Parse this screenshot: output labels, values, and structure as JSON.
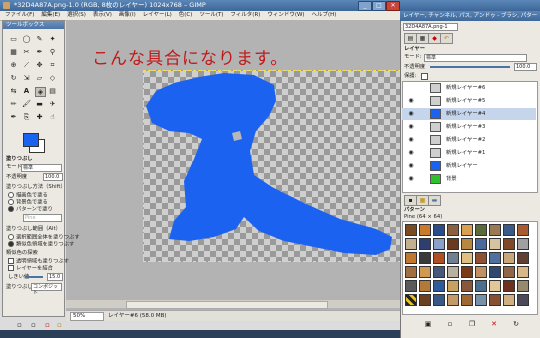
{
  "window": {
    "title": "*32D4A87A.png-1.0 (RGB, 8枚のレイヤー) 1024x768 – GIMP",
    "controls": [
      "_",
      "□",
      "✕"
    ]
  },
  "menubar": [
    "ファイル(F)",
    "編集(E)",
    "選択(S)",
    "表示(V)",
    "画像(I)",
    "レイヤー(L)",
    "色(C)",
    "ツール(T)",
    "フィルタ(R)",
    "ウィンドウ(W)",
    "ヘルプ(H)"
  ],
  "caption": "こんな具合になります。",
  "toolbox": {
    "title": "ツールボックス",
    "section_title": "塗りつぶし",
    "mode_label": "モード:",
    "mode_value": "標準",
    "opacity_label": "不透明度",
    "opacity_value": "100.0",
    "fill_type_label": "塗りつぶし方法（Shift）",
    "fill_types": [
      "描画色で塗る",
      "背景色で塗る",
      "パターンで塗り"
    ],
    "pattern_name": "Pine",
    "area_label": "塗りつぶし範囲（Alt）",
    "area_options": [
      "選択範囲全体を塗りつぶす",
      "類似色領域を塗りつぶす"
    ],
    "similar_label": "類似色の探索",
    "similar_options": [
      "透明領域も塗りつぶす",
      "レイヤーを結合"
    ],
    "threshold_label": "しきい値",
    "threshold_value": "15.0",
    "criterion_label": "塗りつぶし基準",
    "criterion_value": "コンポジット"
  },
  "statusbar": {
    "zoom": "50%",
    "text": "レイヤー#6 (58.0 MB)"
  },
  "dock": {
    "title": "レイヤー, チャンネル, パス, アンドゥ - ブラシ, パターン...",
    "image_menu": "32D4A87A.png-1",
    "layers_title": "レイヤー",
    "mode_label": "モード:",
    "mode_value": "標準",
    "opacity_label": "不透明度",
    "opacity_value": "100.0",
    "lock_label": "保護:",
    "layers": [
      "新規レイヤー#6",
      "新規レイヤー#5",
      "新規レイヤー#4",
      "新規レイヤー#3",
      "新規レイヤー#2",
      "新規レイヤー#1",
      "新規レイヤー",
      "背景"
    ],
    "patterns_title": "パターン",
    "pattern_selected": "Pine (64 × 64)",
    "colors": {
      "fg": "#1c62f0",
      "fill": "#1c62f0",
      "bg_layer": "#2fc12b",
      "caption": "#c21919"
    }
  }
}
